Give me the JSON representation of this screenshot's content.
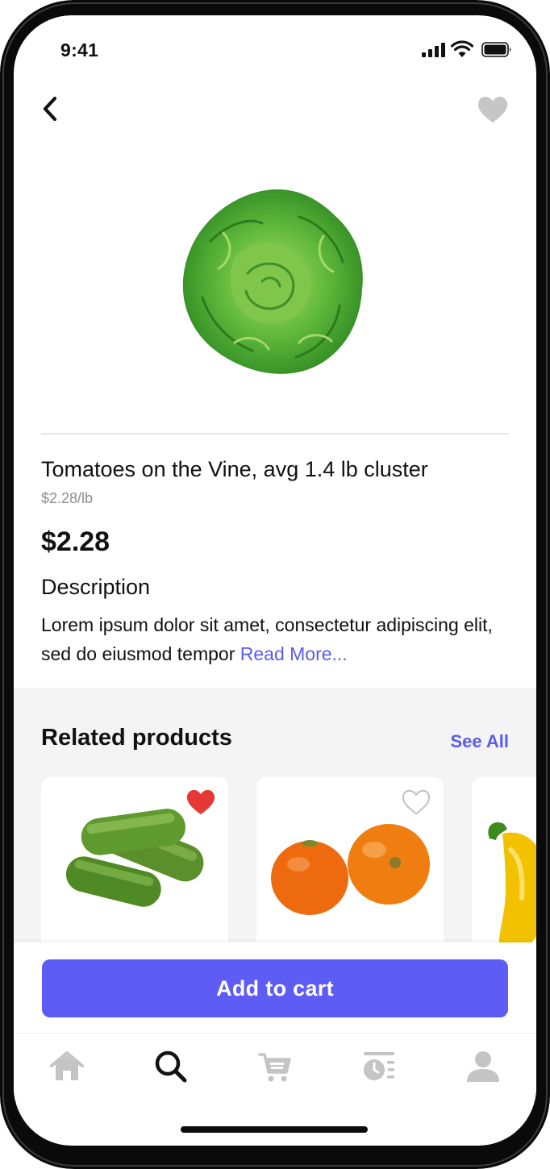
{
  "status_bar": {
    "time": "9:41"
  },
  "product": {
    "title": "Tomatoes on the Vine, avg 1.4 lb cluster",
    "unit_price": "$2.28/lb",
    "price": "$2.28",
    "image": "lettuce-image",
    "favorited": false
  },
  "description": {
    "heading": "Description",
    "text": "Lorem ipsum dolor sit amet, consectetur adipiscing elit, sed do eiusmod tempor ",
    "read_more": "Read More..."
  },
  "related": {
    "heading": "Related products",
    "see_all": "See All",
    "items": [
      {
        "image": "cucumbers-image",
        "favorited": true
      },
      {
        "image": "tomatoes-image",
        "favorited": false
      },
      {
        "image": "yellow-pepper-image",
        "favorited": false
      }
    ]
  },
  "cta": {
    "label": "Add to cart"
  },
  "tabbar": {
    "items": [
      {
        "icon": "home-icon",
        "active": false
      },
      {
        "icon": "search-icon",
        "active": true
      },
      {
        "icon": "cart-icon",
        "active": false
      },
      {
        "icon": "orders-history-icon",
        "active": false
      },
      {
        "icon": "profile-icon",
        "active": false
      }
    ]
  },
  "colors": {
    "accent": "#5d5cf5",
    "link": "#5b5bf0",
    "favorite_active": "#e53935",
    "icon_inactive": "#c4c4c4"
  }
}
